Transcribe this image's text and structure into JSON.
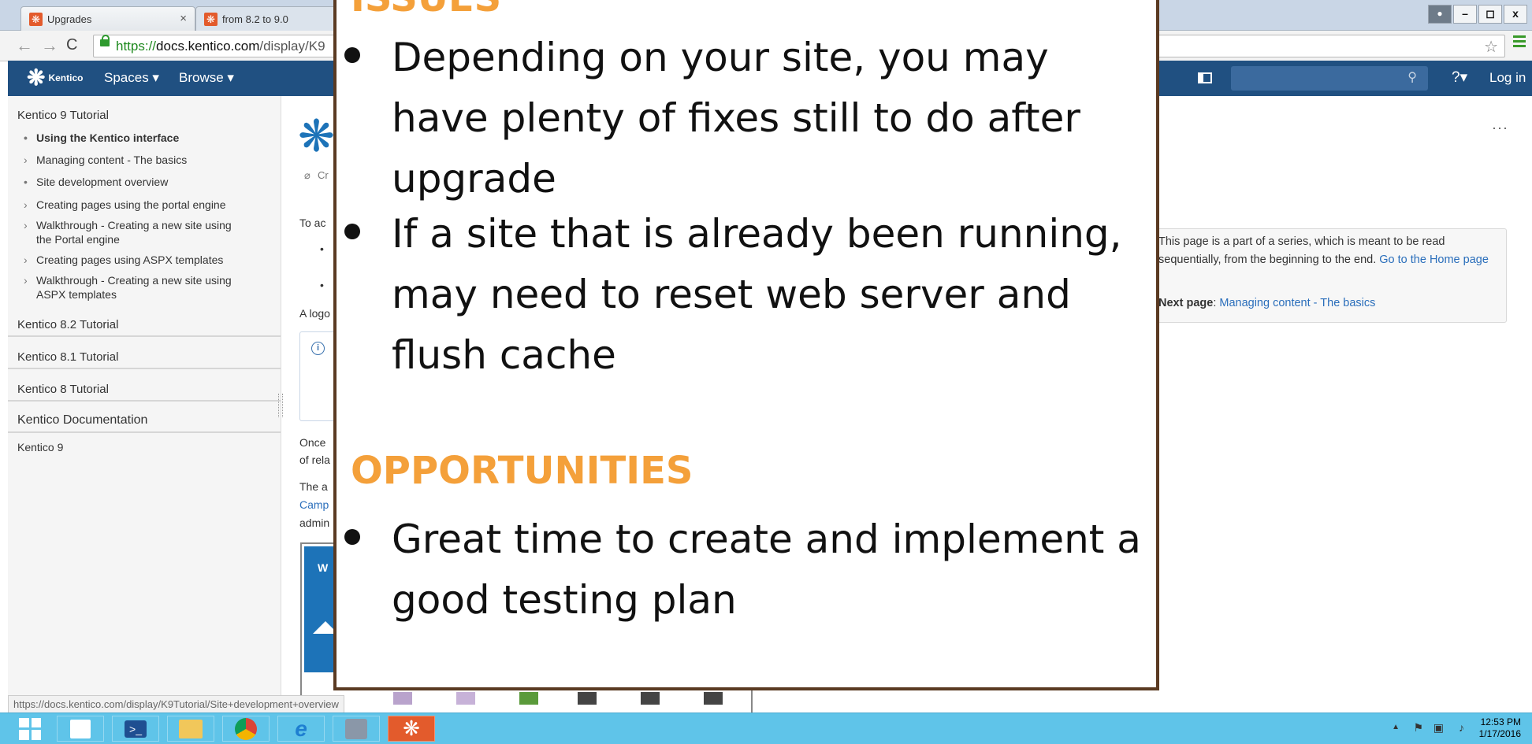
{
  "browser": {
    "tabs": [
      {
        "title": "Upgrades",
        "close": "×"
      },
      {
        "title": "from 8.2 to 9.0"
      }
    ],
    "address": {
      "scheme": "https",
      "host": "docs.kentico.com",
      "path": "/display/K9"
    },
    "window_controls": [
      "–",
      "◻",
      "x"
    ]
  },
  "confluence_header": {
    "logo_text": "Kentico",
    "nav": [
      {
        "label": "Spaces ▾"
      },
      {
        "label": "Browse ▾"
      }
    ],
    "help": "?▾",
    "login": "Log in"
  },
  "sidebar": {
    "space_title": "Kentico 9 Tutorial",
    "items": [
      {
        "marker": "•",
        "label": "Using the Kentico interface",
        "bold": true
      },
      {
        "marker": "›",
        "label": "Managing content - The basics"
      },
      {
        "marker": "•",
        "label": "Site development overview"
      },
      {
        "marker": "›",
        "label": "Creating pages using the portal engine"
      },
      {
        "marker": "›",
        "label": "Walkthrough - Creating a new site using the Portal engine"
      },
      {
        "marker": "›",
        "label": "Creating pages using ASPX templates"
      },
      {
        "marker": "›",
        "label": "Walkthrough - Creating a new site using ASPX templates"
      }
    ],
    "sections": [
      "Kentico 8.2 Tutorial",
      "Kentico 8.1 Tutorial",
      "Kentico 8 Tutorial",
      "Kentico Documentation",
      "Kentico 9"
    ]
  },
  "main": {
    "fragments": {
      "cr": "Cr",
      "to_ac": "To ac",
      "a_logo": "A logo",
      "once": "Once",
      "of_rela": "of rela",
      "the_a": "The a",
      "camp": "Camp",
      "admin": "admin"
    },
    "thumb_heading": "W",
    "series_note": {
      "text": "This page is a part of a series, which is meant to be read sequentially, from the beginning to the end.",
      "link": "Go to the Home page",
      "next_label": "Next page",
      "next_link": "Managing content - The basics"
    },
    "more": "···"
  },
  "status_url": "https://docs.kentico.com/display/K9Tutorial/Site+development+overview",
  "slide": {
    "issues_heading": "ISSUES",
    "issues": [
      "Depending on your site, you may have plenty of fixes still to do after upgrade",
      "If a site that is already been running, may need to reset web server and flush cache"
    ],
    "opportunities_heading": "OPPORTUNITIES",
    "opportunities": [
      "Great time to create and implement a good testing plan"
    ]
  },
  "taskbar": {
    "time": "12:53 PM",
    "date": "1/17/2016"
  },
  "colors": {
    "confluence_header": "#205081",
    "heading_orange": "#f4a03a",
    "slide_border": "#5a3a22",
    "taskbar": "#5fc4e9"
  }
}
